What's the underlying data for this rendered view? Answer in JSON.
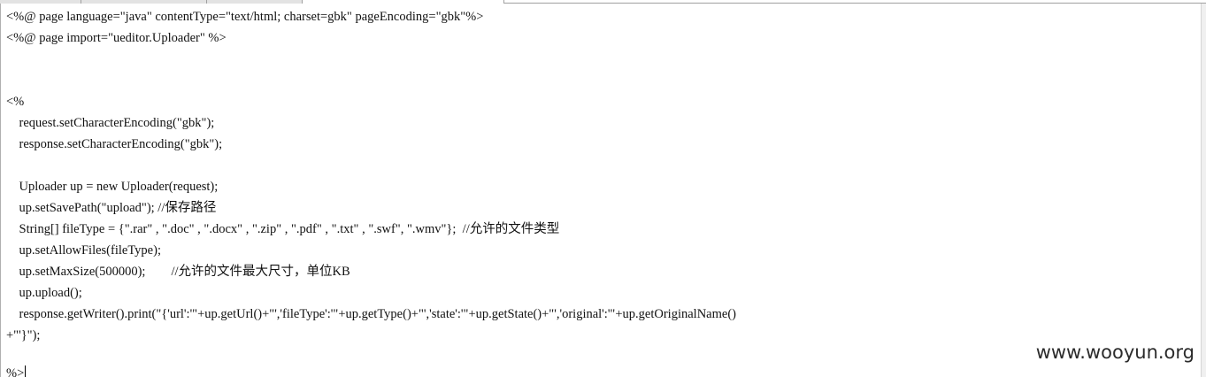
{
  "editor": {
    "lines": [
      "<%@ page language=\"java\" contentType=\"text/html; charset=gbk\" pageEncoding=\"gbk\"%>",
      "<%@ page import=\"ueditor.Uploader\" %>",
      "",
      "",
      "<%",
      "    request.setCharacterEncoding(\"gbk\");",
      "    response.setCharacterEncoding(\"gbk\");",
      "",
      "    Uploader up = new Uploader(request);",
      "    up.setSavePath(\"upload\"); //保存路径",
      "    String[] fileType = {\".rar\" , \".doc\" , \".docx\" , \".zip\" , \".pdf\" , \".txt\" , \".swf\", \".wmv\"};  //允许的文件类型",
      "    up.setAllowFiles(fileType);",
      "    up.setMaxSize(500000);        //允许的文件最大尺寸，单位KB",
      "    up.upload();",
      "    response.getWriter().print(\"{'url':'\"+up.getUrl()+\"','fileType':'\"+up.getType()+\"','state':'\"+up.getState()+\"','original':'\"+up.getOriginalName()",
      "+\"'}\");",
      "",
      "%>"
    ]
  },
  "watermark": {
    "text": "www.wooyun.org"
  }
}
